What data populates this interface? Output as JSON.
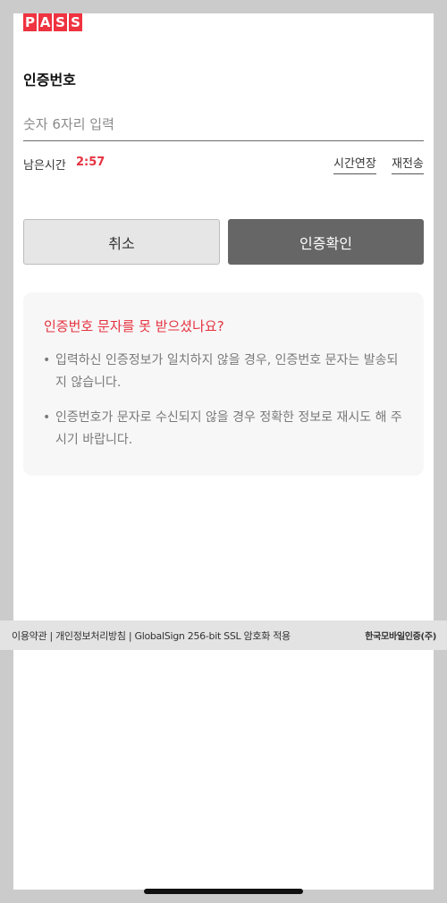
{
  "logo": {
    "letters": [
      "P",
      "A",
      "S",
      "S"
    ],
    "color": "#ef3340"
  },
  "auth": {
    "title": "인증번호",
    "input_placeholder": "숫자 6자리 입력",
    "input_value": "",
    "remaining_label": "남은시간",
    "remaining_time": "2:57",
    "extend_label": "시간연장",
    "resend_label": "재전송"
  },
  "buttons": {
    "cancel_label": "취소",
    "confirm_label": "인증확인"
  },
  "help": {
    "title": "인증번호 문자를 못 받으셨나요?",
    "items": [
      "입력하신 인증정보가 일치하지 않을 경우, 인증번호 문자는 발송되지 않습니다.",
      "인증번호가 문자로 수신되지 않을 경우 정확한 정보로 재시도 해 주시기 바랍니다."
    ]
  },
  "footer": {
    "terms": "이용약관",
    "separator": " | ",
    "privacy": "개인정보처리방침",
    "security": "GlobalSign 256-bit SSL 암호화 적용",
    "brand": "한국모바일인증(주)"
  },
  "colors": {
    "accent": "#e5323f",
    "confirm_button": "#666666",
    "cancel_button": "#e6e6e6"
  }
}
